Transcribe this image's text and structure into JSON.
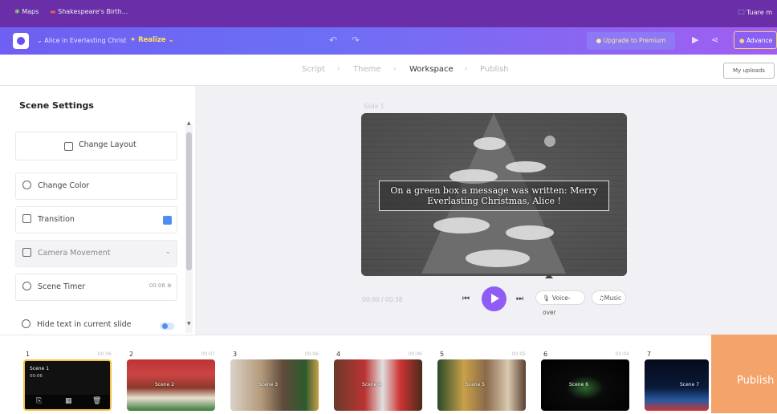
{
  "browser": {
    "bookmarks": [
      "Maps",
      "Shakespeare's Birth..."
    ],
    "right_item": "Tuare m"
  },
  "header": {
    "project_name": "Alice in Everlasting Christ",
    "realize_label": "Realize",
    "upgrade_label": "Upgrade to Premium",
    "advanced_label": "Advance"
  },
  "steps": {
    "items": [
      "Script",
      "Theme",
      "Workspace",
      "Publish"
    ],
    "active": "Workspace",
    "my_uploads": "My uploads"
  },
  "scene_settings": {
    "title": "Scene Settings",
    "change_layout": "Change Layout",
    "change_color": "Change Color",
    "transition": "Transition",
    "camera_movement": "Camera Movement",
    "scene_timer": "Scene Timer",
    "scene_timer_value": "00:06",
    "hide_text": "Hide text in current slide"
  },
  "canvas": {
    "slide_label": "Slide 1",
    "slide_text": "On a green box a message was written: Merry Everlasting Christmas, Alice !",
    "time_display": "00:00 / 00:38",
    "voiceover_label": "Voice-over",
    "music_label": "Music"
  },
  "timeline": {
    "scenes": [
      {
        "number": "1",
        "duration": "00:06",
        "tag": "Scene 1",
        "sub": "00:06"
      },
      {
        "number": "2",
        "duration": "00:07",
        "tag": "Scene 2"
      },
      {
        "number": "3",
        "duration": "00:06",
        "tag": "Scene 3"
      },
      {
        "number": "4",
        "duration": "00:06",
        "tag": "Scene 4"
      },
      {
        "number": "5",
        "duration": "00:05",
        "tag": "Scene 5"
      },
      {
        "number": "6",
        "duration": "00:04",
        "tag": "Scene 6"
      },
      {
        "number": "7",
        "duration": "",
        "tag": "Scene 7"
      }
    ],
    "publish_label": "Publish"
  },
  "colors": {
    "header_gradient_start": "#6f5ff2",
    "header_gradient_end": "#a25ef0",
    "play_button": "#8f5cf6",
    "publish_panel": "#f4a46a",
    "selected_scene_border": "#f5c242"
  }
}
